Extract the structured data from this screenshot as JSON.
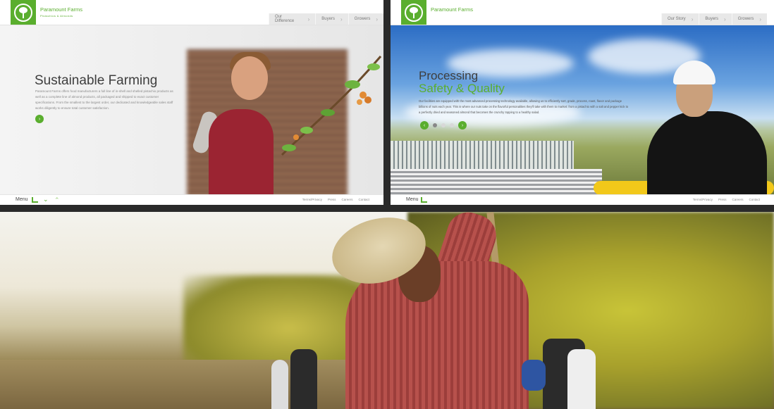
{
  "panel1": {
    "brand": "Paramount Farms",
    "brand_tagline": "Pistachios & Almonds",
    "nav": [
      "Our Difference",
      "Buyers",
      "Growers"
    ],
    "title": "Sustainable Farming",
    "body": "Paramount Farms offers food manufacturers a full line of in-shell and shelled pistachio products as well as a complete line of almond products, all packaged and shipped to exact customer specifications. From the smallest to the largest order, our dedicated and knowledgeable sales staff works diligently to ensure total customer satisfaction.",
    "menu_label": "Menu",
    "footer": [
      "Terms/Privacy",
      "Press",
      "Careers",
      "Contact"
    ]
  },
  "panel2": {
    "brand": "Paramount Farms",
    "nav": [
      "Our Story",
      "Buyers",
      "Growers"
    ],
    "title_line1": "Processing",
    "title_line2": "Safety & Quality",
    "body": "Our facilities are equipped with the most advanced processing technology available, allowing us to efficiently sort, grade, process, roast, flavor and package billions of nuts each year. This is where our nuts take on the flavorful personalities they’ll take with them to market: from a pistachio with a salt and pepper kick to a perfectly dried and seasoned almond that becomes the crunchy topping to a healthy salad.",
    "menu_label": "Menu",
    "footer": [
      "Terms/Privacy",
      "Press",
      "Careers",
      "Contact"
    ]
  },
  "colors": {
    "brand_green": "#5aae2e",
    "text_dark": "#3e3e3e"
  }
}
